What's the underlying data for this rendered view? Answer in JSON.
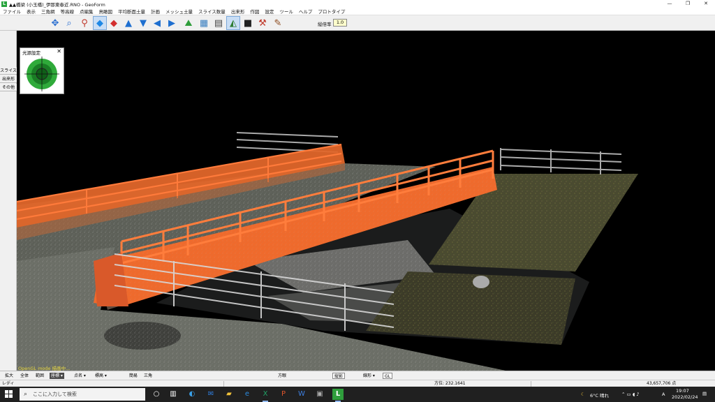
{
  "window": {
    "title": "▲▲橋梁 (小玉橋)_伊那東春近.RNO - GeoForm",
    "app_icon": "L",
    "controls": [
      "—",
      "❐",
      "✕"
    ]
  },
  "menu": [
    "ファイル",
    "表示",
    "三角網",
    "等高線",
    "点編集",
    "鳥瞰図",
    "平均断面土量",
    "計画",
    "メッシュ土量",
    "スライス数量",
    "出来形",
    "作図",
    "設定",
    "ツール",
    "ヘルプ",
    "プロトタイプ"
  ],
  "toolbar": {
    "scale_label": "縦倍率",
    "scale_value": "1.0",
    "icons": [
      "move-icon",
      "zoom-icon",
      "axis-icon",
      "cube-blue-icon",
      "cube-red-icon",
      "arrow-up-icon",
      "arrow-down-icon",
      "arrow-left-icon",
      "arrow-right-icon",
      "terrain-icon",
      "section-icon",
      "mesh-icon",
      "light-icon",
      "display-icon",
      "tool-icon",
      "paint-icon"
    ]
  },
  "light_panel": {
    "title": "光源設定",
    "close": "✕"
  },
  "left_panel": {
    "tabs": [
      "スライス",
      "出来形",
      "その他"
    ]
  },
  "viewport": {
    "overlay": "OpenGL mode   描画中..."
  },
  "bottom_bar": {
    "buttons": [
      "拡大",
      "全体",
      "範囲",
      "座標 ▾",
      "点名 ▾",
      "標高 ▾",
      "簡易",
      "三角",
      "方眼",
      "縦影",
      "線形 ▾",
      "GL"
    ]
  },
  "status": {
    "ready": "レディ",
    "direction": "方位: 232.1641",
    "points": "43,657,706 点"
  },
  "taskbar": {
    "search_placeholder": "ここに入力して検索",
    "weather": "6°C 晴れ",
    "ime": "A",
    "time": "19:07",
    "date": "2022/02/24"
  }
}
